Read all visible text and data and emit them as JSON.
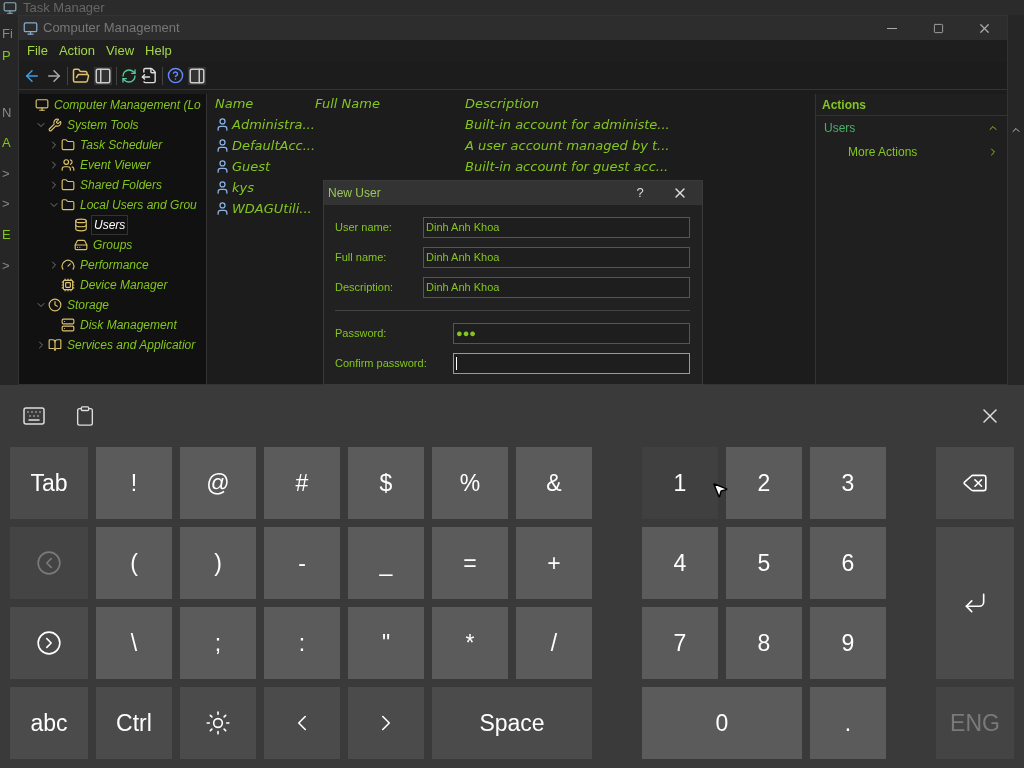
{
  "background_window": {
    "title": "Task Manager",
    "fragments": [
      "Fi",
      "P",
      "N",
      "A",
      ">",
      ">",
      "E",
      ">"
    ]
  },
  "window": {
    "title": "Computer Management"
  },
  "menu": [
    "File",
    "Action",
    "View",
    "Help"
  ],
  "tree": [
    {
      "label": "Computer Management (Lo",
      "selected": false,
      "children": [
        {
          "label": "System Tools",
          "expanded": true,
          "selected": false,
          "children": [
            {
              "label": "Task Scheduler",
              "expanded": false,
              "selected": false
            },
            {
              "label": "Event Viewer",
              "expanded": false,
              "selected": false
            },
            {
              "label": "Shared Folders",
              "expanded": false,
              "selected": false
            },
            {
              "label": "Local Users and Grou",
              "expanded": true,
              "selected": false,
              "children": [
                {
                  "label": "Users",
                  "selected": true
                },
                {
                  "label": "Groups",
                  "selected": false
                }
              ]
            },
            {
              "label": "Performance",
              "expanded": false,
              "selected": false
            },
            {
              "label": "Device Manager",
              "selected": false
            }
          ]
        },
        {
          "label": "Storage",
          "expanded": true,
          "selected": false,
          "children": [
            {
              "label": "Disk Management",
              "selected": false
            }
          ]
        },
        {
          "label": "Services and Applicatior",
          "expanded": false,
          "selected": false
        }
      ]
    }
  ],
  "table": {
    "columns": [
      "Name",
      "Full Name",
      "Description"
    ],
    "rows": [
      {
        "name": "Administra...",
        "description": "Built-in account for administe..."
      },
      {
        "name": "DefaultAcc...",
        "description": "A user account managed by t..."
      },
      {
        "name": "Guest",
        "description": "Built-in account for guest acc..."
      },
      {
        "name": "kys"
      },
      {
        "name": "WDAGUtili..."
      }
    ]
  },
  "actions": {
    "title": "Actions",
    "section": "Users",
    "items": [
      "More Actions"
    ]
  },
  "dialog": {
    "title": "New User",
    "help": "?",
    "fields": [
      {
        "label": "User name:",
        "value": "Dinh Anh Khoa",
        "focused": false
      },
      {
        "label": "Full name:",
        "value": "Dinh Anh Khoa",
        "focused": false
      },
      {
        "label": "Description:",
        "value": "Dinh Anh Khoa",
        "focused": false
      }
    ],
    "password_fields": [
      {
        "label": "Password:",
        "value": "●●●",
        "focused": false
      },
      {
        "label": "Confirm password:",
        "focused": true
      }
    ]
  },
  "keyboard": {
    "rows": [
      {
        "left": {
          "kind": "text",
          "label": "Tab",
          "disabled": false
        },
        "symbols": [
          {
            "label": "!"
          },
          {
            "label": "@"
          },
          {
            "label": "#"
          },
          {
            "label": "$"
          },
          {
            "label": "%"
          },
          {
            "label": "&"
          }
        ],
        "numbers": [
          {
            "label": "1",
            "pressed": true
          },
          {
            "label": "2",
            "pressed": false
          },
          {
            "label": "3",
            "pressed": false
          }
        ],
        "right": {
          "kind": "backspace",
          "disabled": false
        }
      },
      {
        "left": {
          "kind": "back",
          "disabled": true
        },
        "symbols": [
          {
            "label": "("
          },
          {
            "label": ")"
          },
          {
            "label": "-"
          },
          {
            "label": "_"
          },
          {
            "label": "="
          },
          {
            "label": "+"
          }
        ],
        "numbers": [
          {
            "label": "4",
            "pressed": false
          },
          {
            "label": "5",
            "pressed": false
          },
          {
            "label": "6",
            "pressed": false
          }
        ],
        "right": {
          "kind": "enter",
          "disabled": false
        }
      },
      {
        "left": {
          "kind": "forward",
          "disabled": false
        },
        "symbols": [
          {
            "label": "\\"
          },
          {
            "label": ";"
          },
          {
            "label": ":"
          },
          {
            "label": "\""
          },
          {
            "label": "*"
          },
          {
            "label": "/"
          }
        ],
        "numbers": [
          {
            "label": "7",
            "pressed": false
          },
          {
            "label": "8",
            "pressed": false
          },
          {
            "label": "9",
            "pressed": false
          }
        ]
      },
      {
        "left": {
          "kind": "text",
          "label": "abc",
          "disabled": false
        },
        "symbols": [
          {
            "label": "Ctrl"
          },
          {
            "kind": "brightness"
          },
          {
            "kind": "left"
          },
          {
            "kind": "right"
          },
          {
            "label": "Space",
            "wide": true
          }
        ],
        "numbers": [
          {
            "label": "0",
            "pressed": false,
            "wide": true
          },
          {
            "label": ".",
            "pressed": false
          }
        ],
        "right": {
          "kind": "text",
          "label": "ENG",
          "disabled": true
        }
      }
    ]
  }
}
